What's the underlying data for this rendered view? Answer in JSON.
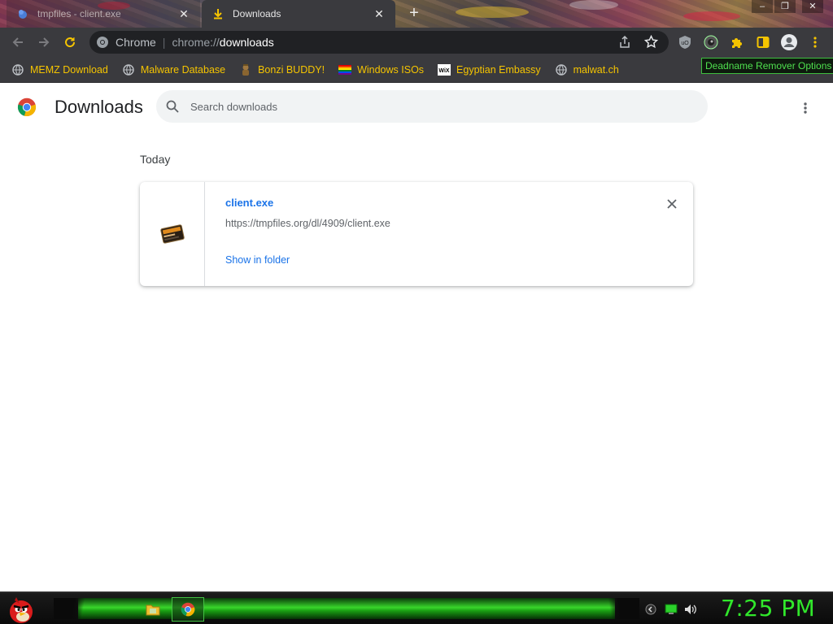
{
  "tabs": [
    {
      "title": "tmpfiles - client.exe",
      "active": false
    },
    {
      "title": "Downloads",
      "active": true
    }
  ],
  "window_controls": {
    "minimize": "–",
    "restore": "❐",
    "close": "✕"
  },
  "omnibox": {
    "site_label": "Chrome",
    "url_scheme": "chrome://",
    "url_host": "downloads"
  },
  "bookmarks": [
    {
      "label": "MEMZ Download",
      "icon": "globe-icon"
    },
    {
      "label": "Malware Database",
      "icon": "globe-icon"
    },
    {
      "label": "Bonzi BUDDY!",
      "icon": "bonzi-icon"
    },
    {
      "label": "Windows ISOs",
      "icon": "rainbow-flag-icon"
    },
    {
      "label": "Egyptian Embassy",
      "icon": "wix-icon"
    },
    {
      "label": "malwat.ch",
      "icon": "globe-icon"
    }
  ],
  "tooltip": "Deadname Remover Options",
  "downloads_page": {
    "title": "Downloads",
    "search_placeholder": "Search downloads",
    "section_date": "Today",
    "items": [
      {
        "file_name": "client.exe",
        "url": "https://tmpfiles.org/dl/4909/client.exe",
        "action": "Show in folder"
      }
    ]
  },
  "taskbar": {
    "clock": "7:25 PM"
  },
  "colors": {
    "chrome_dark": "#3a3a3e",
    "bookmark_text": "#f5c400",
    "link_blue": "#1a73e8",
    "taskbar_green": "#31e82b",
    "tooltip_green": "#4fe04f"
  }
}
